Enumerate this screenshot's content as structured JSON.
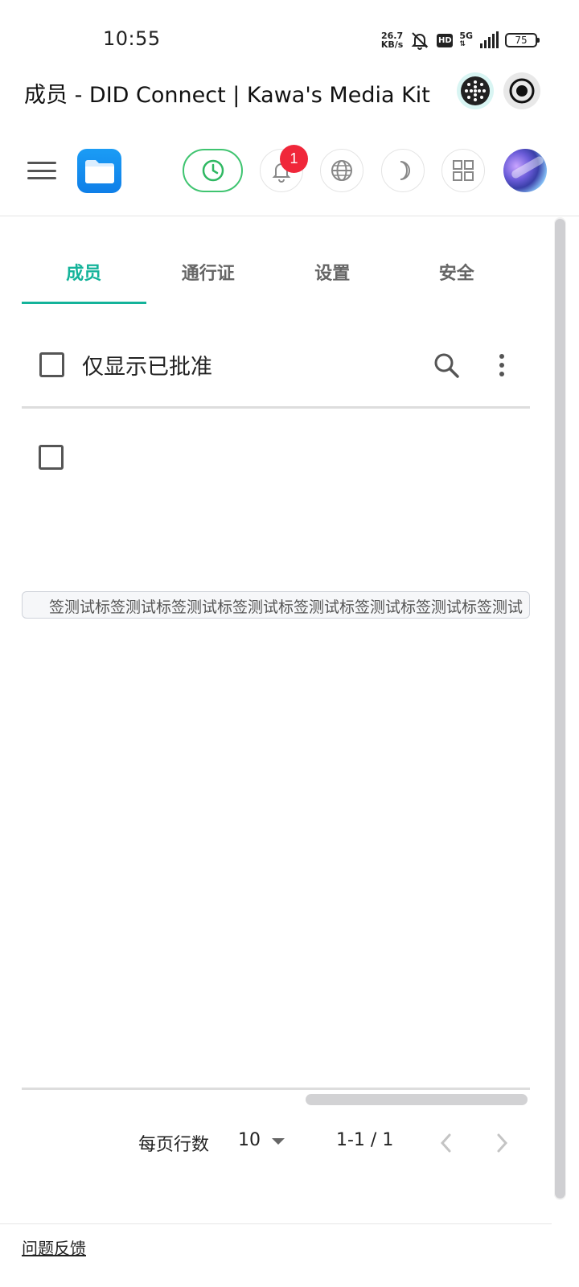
{
  "status_bar": {
    "time": "10:55",
    "net_speed_value": "26.7",
    "net_speed_unit": "KB/s",
    "hd_label": "HD",
    "network_label": "5G",
    "battery": "75",
    "icons": [
      "mute-bell-icon",
      "signal-icon"
    ]
  },
  "title_bar": {
    "title": "成员 - DID Connect | Kawa's Media Kit"
  },
  "header": {
    "notification_count": "1",
    "icons": [
      "menu-icon",
      "app-logo",
      "clock-icon",
      "bell-icon",
      "globe-icon",
      "moon-icon",
      "apps-icon",
      "avatar"
    ]
  },
  "tabs": [
    {
      "label": "成员",
      "active": true
    },
    {
      "label": "通行证",
      "active": false
    },
    {
      "label": "设置",
      "active": false
    },
    {
      "label": "安全",
      "active": false
    }
  ],
  "toolbar": {
    "filter_label": "仅显示已批准",
    "filter_checked": false
  },
  "table": {
    "rows": [
      {
        "checked": false,
        "tag": "签测试标签测试标签测试标签测试标签测试标签测试标签测试标签测试"
      }
    ]
  },
  "pagination": {
    "rows_per_page_label": "每页行数",
    "rows_per_page": "10",
    "range": "1-1 / 1"
  },
  "footer": {
    "feedback": "问题反馈"
  },
  "colors": {
    "accent": "#14b39a",
    "session_green": "#3fc470",
    "badge_red": "#f0273a"
  }
}
